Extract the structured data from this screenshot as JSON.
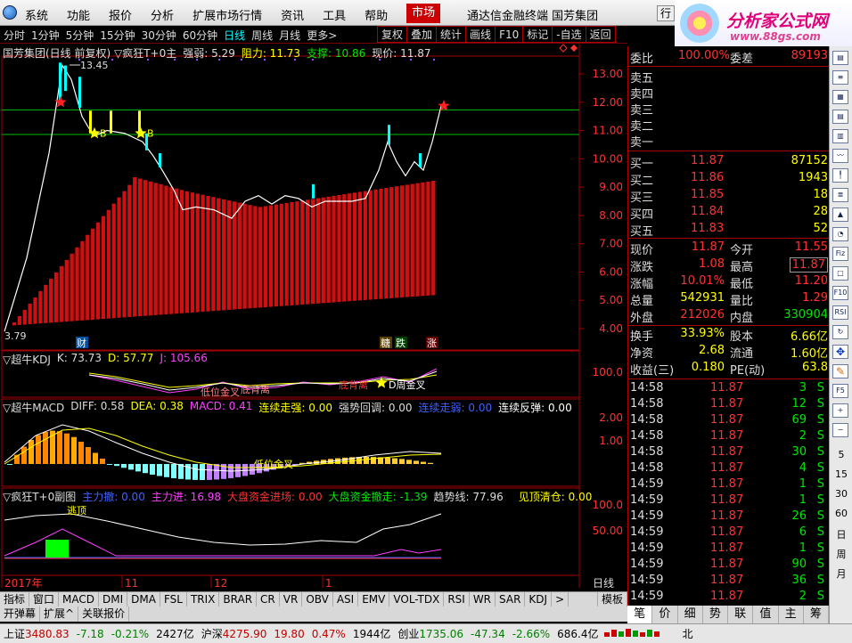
{
  "menu": {
    "items": [
      "系统",
      "功能",
      "报价",
      "分析",
      "扩展市场行情",
      "资讯",
      "工具",
      "帮助"
    ],
    "active": "市场",
    "app_title": "通达信金融终端  国芳集团",
    "window_button": "行"
  },
  "brand": {
    "name": "分析家公式网",
    "url": "www.88gs.com"
  },
  "toolbar": {
    "periods": [
      "分时",
      "1分钟",
      "5分钟",
      "15分钟",
      "30分钟",
      "60分钟",
      "日线",
      "周线",
      "月线",
      "更多>"
    ],
    "active_period": "日线",
    "tools": [
      "复权",
      "叠加",
      "统计",
      "画线",
      "F10",
      "标记",
      "-自选",
      "返回"
    ]
  },
  "main_header": {
    "title": "国芳集团(日线 前复权) ▽疯狂T+0主",
    "strength_label": "强弱: 5.29",
    "resistance": "阻力: 11.73",
    "support": "支撑: 10.86",
    "price": "现价: 11.87"
  },
  "main_axis": {
    "ticks": [
      "13.00",
      "12.00",
      "11.00",
      "10.00",
      "9.00",
      "8.00",
      "7.00",
      "6.00",
      "5.00",
      "4.00"
    ]
  },
  "main_annotations": {
    "high": "13.45",
    "low": "3.79",
    "label_b1": "B",
    "label_b2": "B",
    "marker_cai": "财",
    "marker_1": "糖",
    "marker_2": "跌",
    "marker_3": "涨"
  },
  "kdj": {
    "title": "▽超牛KDJ",
    "k": "K: 73.73",
    "d": "D: 57.77",
    "j": "J: 105.66",
    "tick": "100.0",
    "ann1": "低位金叉",
    "ann2": "底背离",
    "ann3": "底背离",
    "ann4": "D周金叉"
  },
  "macd": {
    "title": "▽超牛MACD",
    "diff": "DIFF: 0.58",
    "dea": "DEA: 0.38",
    "macd": "MACD: 0.41",
    "s1": "连续走强: 0.00",
    "s2": "强势回调: 0.00",
    "s3": "连续走弱: 0.00",
    "s4": "连续反弹: 0.00",
    "ticks": [
      "2.00",
      "1.00"
    ],
    "ann": "低位金叉"
  },
  "sub3": {
    "title": "▽疯狂T+0副图",
    "a": "主力撤: 0.00",
    "b": "主力进: 16.98",
    "c": "大盘资金进场: 0.00",
    "d": "大盘资金撤走: -1.39",
    "e": "趋势线: 77.96",
    "f": "见顶清仓: 0.00",
    "ticks": [
      "100.0",
      "50.00"
    ],
    "ann": "逃顶"
  },
  "xaxis": {
    "labels": [
      "2017年",
      "11",
      "12",
      "1"
    ],
    "period": "日线"
  },
  "bottom_tabs": [
    "指标",
    "窗口",
    "MACD",
    "DMI",
    "DMA",
    "FSL",
    "TRIX",
    "BRAR",
    "CR",
    "VR",
    "OBV",
    "ASI",
    "EMV",
    "VOL-TDX",
    "RSI",
    "WR",
    "SAR",
    "KDJ",
    ">"
  ],
  "bottom_tabs_right": "模板",
  "bottom_tabs2": [
    "开弹幕",
    "扩展^",
    "关联报价"
  ],
  "orderbook": {
    "commission_ratio_label": "委比",
    "commission_ratio": "100.00%",
    "commission_diff_label": "委差",
    "commission_diff": "89193",
    "sell": [
      {
        "label": "卖五",
        "price": "",
        "vol": ""
      },
      {
        "label": "卖四",
        "price": "",
        "vol": ""
      },
      {
        "label": "卖三",
        "price": "",
        "vol": ""
      },
      {
        "label": "卖二",
        "price": "",
        "vol": ""
      },
      {
        "label": "卖一",
        "price": "",
        "vol": ""
      }
    ],
    "buy": [
      {
        "label": "买一",
        "price": "11.87",
        "vol": "87152"
      },
      {
        "label": "买二",
        "price": "11.86",
        "vol": "1943"
      },
      {
        "label": "买三",
        "price": "11.85",
        "vol": "18"
      },
      {
        "label": "买四",
        "price": "11.84",
        "vol": "28"
      },
      {
        "label": "买五",
        "price": "11.83",
        "vol": "52"
      }
    ]
  },
  "quote": [
    {
      "l1": "现价",
      "v1": "11.87",
      "l2": "今开",
      "v2": "11.55"
    },
    {
      "l1": "涨跌",
      "v1": "1.08",
      "l2": "最高",
      "v2": "11.87"
    },
    {
      "l1": "涨幅",
      "v1": "10.01%",
      "l2": "最低",
      "v2": "11.20"
    },
    {
      "l1": "总量",
      "v1": "542931",
      "l2": "量比",
      "v2": "1.29"
    },
    {
      "l1": "外盘",
      "v1": "212026",
      "l2": "内盘",
      "v2": "330904"
    },
    {
      "l1": "换手",
      "v1": "33.93%",
      "l2": "股本",
      "v2": "6.66亿"
    },
    {
      "l1": "净资",
      "v1": "2.68",
      "l2": "流通",
      "v2": "1.60亿"
    },
    {
      "l1": "收益(三)",
      "v1": "0.180",
      "l2": "PE(动)",
      "v2": "63.8"
    }
  ],
  "ticks": [
    {
      "t": "14:58",
      "p": "11.87",
      "v": "3",
      "s": "S"
    },
    {
      "t": "14:58",
      "p": "11.87",
      "v": "12",
      "s": "S"
    },
    {
      "t": "14:58",
      "p": "11.87",
      "v": "69",
      "s": "S"
    },
    {
      "t": "14:58",
      "p": "11.87",
      "v": "2",
      "s": "S"
    },
    {
      "t": "14:58",
      "p": "11.87",
      "v": "30",
      "s": "S"
    },
    {
      "t": "14:58",
      "p": "11.87",
      "v": "4",
      "s": "S"
    },
    {
      "t": "14:59",
      "p": "11.87",
      "v": "1",
      "s": "S"
    },
    {
      "t": "14:59",
      "p": "11.87",
      "v": "1",
      "s": "S"
    },
    {
      "t": "14:59",
      "p": "11.87",
      "v": "26",
      "s": "S"
    },
    {
      "t": "14:59",
      "p": "11.87",
      "v": "6",
      "s": "S"
    },
    {
      "t": "14:59",
      "p": "11.87",
      "v": "1",
      "s": "S"
    },
    {
      "t": "14:59",
      "p": "11.87",
      "v": "90",
      "s": "S"
    },
    {
      "t": "14:59",
      "p": "11.87",
      "v": "36",
      "s": "S"
    },
    {
      "t": "14:59",
      "p": "11.87",
      "v": "2",
      "s": "S"
    },
    {
      "t": "14:59",
      "p": "11.87",
      "v": "7",
      "s": "S"
    }
  ],
  "right_tabs": [
    "笔",
    "价",
    "细",
    "势",
    "联",
    "值",
    "主",
    "筹"
  ],
  "side_labels": [
    "5",
    "15",
    "30",
    "60",
    "日",
    "周",
    "月"
  ],
  "status": {
    "sh_label": "上证",
    "sh_val": "3480.83",
    "sh_chg": "-7.18",
    "sh_pct": "-0.21%",
    "sh_amt": "2427亿",
    "hs_label": "沪深",
    "hs_val": "4275.90",
    "hs_chg": "19.80",
    "hs_pct": "0.47%",
    "hs_amt": "1944亿",
    "cy_label": "创业",
    "cy_val": "1735.06",
    "cy_chg": "-47.34",
    "cy_pct": "-2.66%",
    "cy_amt": "686.4亿",
    "extra": "北"
  },
  "colors": {
    "red": "#ff3232",
    "green": "#00e600",
    "yellow": "#ffff00",
    "cyan": "#00ffff",
    "magenta": "#ff40ff",
    "grid": "#a00000"
  }
}
